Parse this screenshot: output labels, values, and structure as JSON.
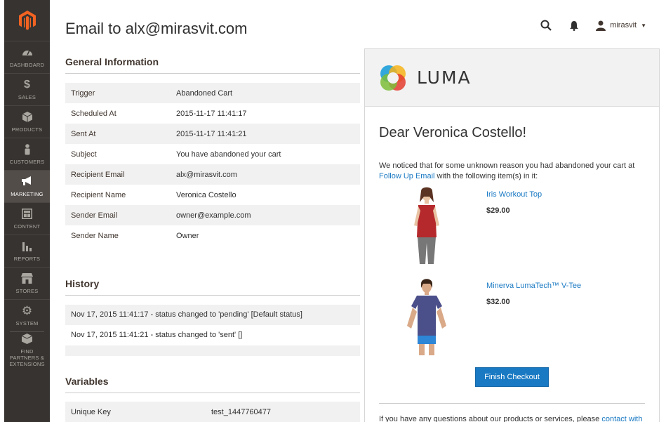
{
  "sidebar": {
    "items": [
      {
        "label": "DASHBOARD",
        "icon": "dashboard-icon"
      },
      {
        "label": "SALES",
        "icon": "dollar-icon"
      },
      {
        "label": "PRODUCTS",
        "icon": "cube-icon"
      },
      {
        "label": "CUSTOMERS",
        "icon": "person-icon"
      },
      {
        "label": "MARKETING",
        "icon": "megaphone-icon",
        "active": true
      },
      {
        "label": "CONTENT",
        "icon": "layout-icon"
      },
      {
        "label": "REPORTS",
        "icon": "bar-chart-icon"
      },
      {
        "label": "STORES",
        "icon": "store-icon"
      },
      {
        "label": "SYSTEM",
        "icon": "gear-icon"
      },
      {
        "label": "FIND PARTNERS & EXTENSIONS",
        "icon": "box-icon"
      }
    ]
  },
  "header": {
    "title": "Email to alx@mirasvit.com",
    "user": "mirasvit"
  },
  "general": {
    "title": "General Information",
    "rows": [
      {
        "key": "Trigger",
        "value": "Abandoned Cart"
      },
      {
        "key": "Scheduled At",
        "value": "2015-11-17 11:41:17"
      },
      {
        "key": "Sent At",
        "value": "2015-11-17 11:41:21"
      },
      {
        "key": "Subject",
        "value": "You have abandoned your cart"
      },
      {
        "key": "Recipient Email",
        "value": "alx@mirasvit.com"
      },
      {
        "key": "Recipient Name",
        "value": "Veronica Costello"
      },
      {
        "key": "Sender Email",
        "value": "owner@example.com"
      },
      {
        "key": "Sender Name",
        "value": "Owner"
      }
    ]
  },
  "history": {
    "title": "History",
    "rows": [
      "Nov 17, 2015 11:41:17 - status changed to 'pending' [Default status]",
      "Nov 17, 2015 11:41:21 - status changed to 'sent' []"
    ]
  },
  "variables": {
    "title": "Variables",
    "rows": [
      {
        "key": "Unique Key",
        "value": "test_1447760477"
      }
    ]
  },
  "email": {
    "brand": "LUMA",
    "greeting": "Dear Veronica Costello!",
    "intro_before": "We noticed that for some unknown reason you had abandoned your cart at ",
    "intro_link": "Follow Up Email",
    "intro_after": " with the following item(s) in it:",
    "products": [
      {
        "name": "Iris Workout Top",
        "price": "$29.00",
        "shirt_color": "#b5292c"
      },
      {
        "name": "Minerva LumaTech™ V-Tee",
        "price": "$32.00",
        "shirt_color": "#4b4f8a"
      }
    ],
    "button": "Finish Checkout",
    "footer_before": "If you have any questions about our products or services, please ",
    "footer_link": "contact with"
  },
  "colors": {
    "sidebar": "#373330",
    "sidebar_active": "#524d49",
    "accent": "#1979c3",
    "magento_logo": "#f26322"
  }
}
